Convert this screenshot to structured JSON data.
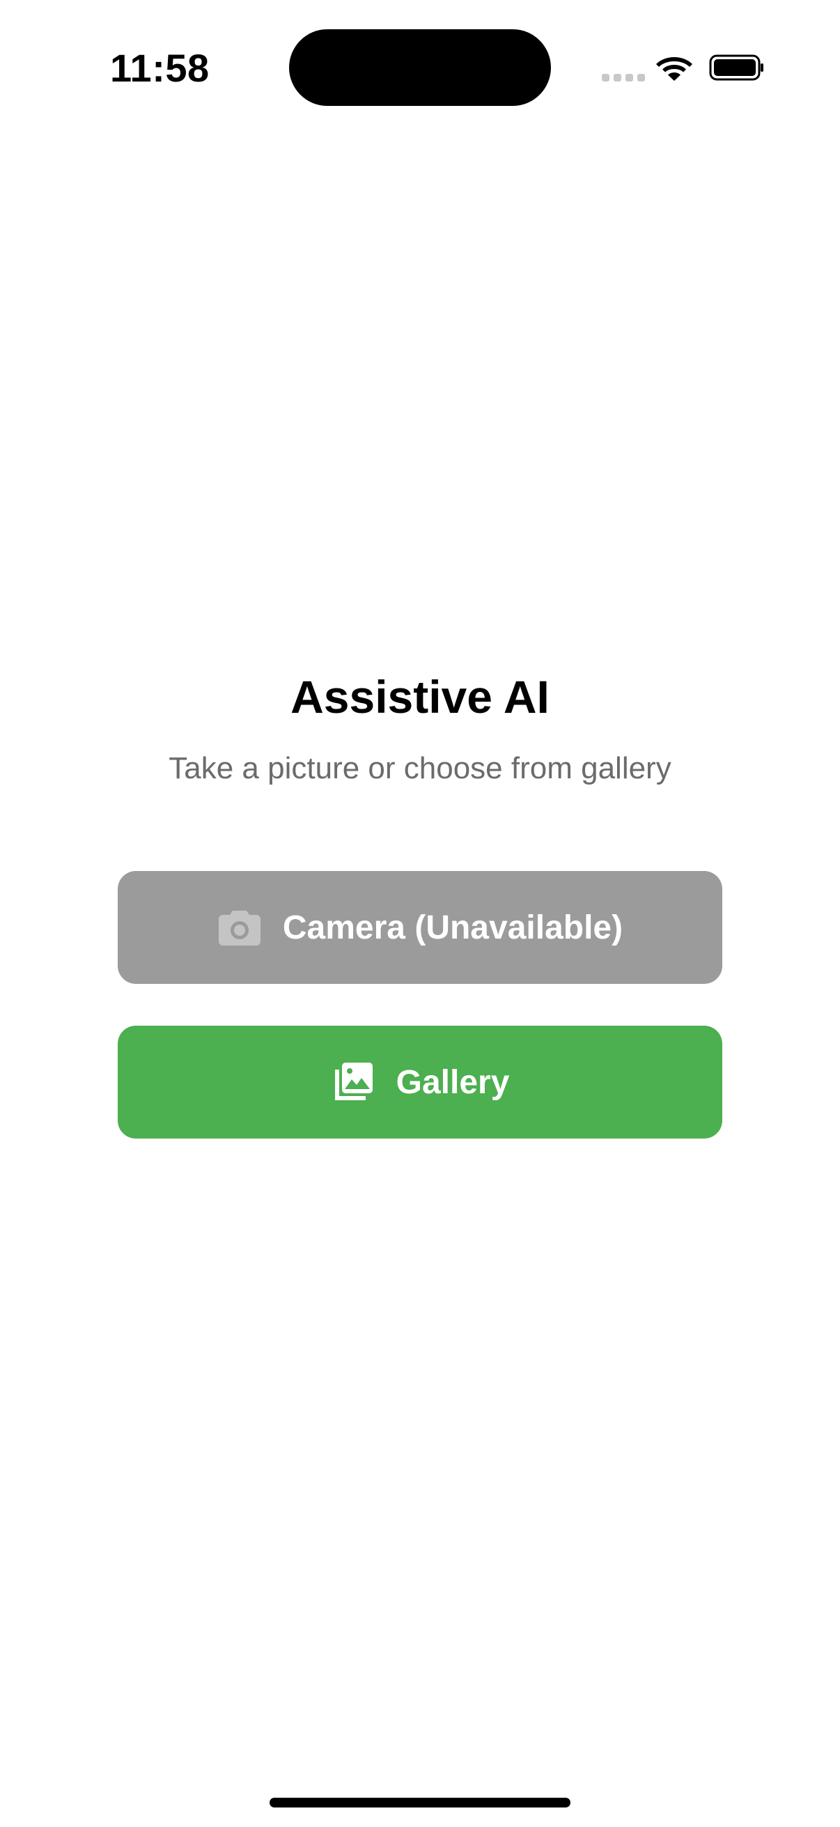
{
  "status_bar": {
    "time": "11:58"
  },
  "main": {
    "title": "Assistive AI",
    "subtitle": "Take a picture or choose from gallery"
  },
  "buttons": {
    "camera": {
      "label": "Camera (Unavailable)",
      "icon": "camera-icon",
      "color": "#9b9b9b",
      "enabled": false
    },
    "gallery": {
      "label": "Gallery",
      "icon": "photo-library-icon",
      "color": "#4caf50",
      "enabled": true
    }
  }
}
